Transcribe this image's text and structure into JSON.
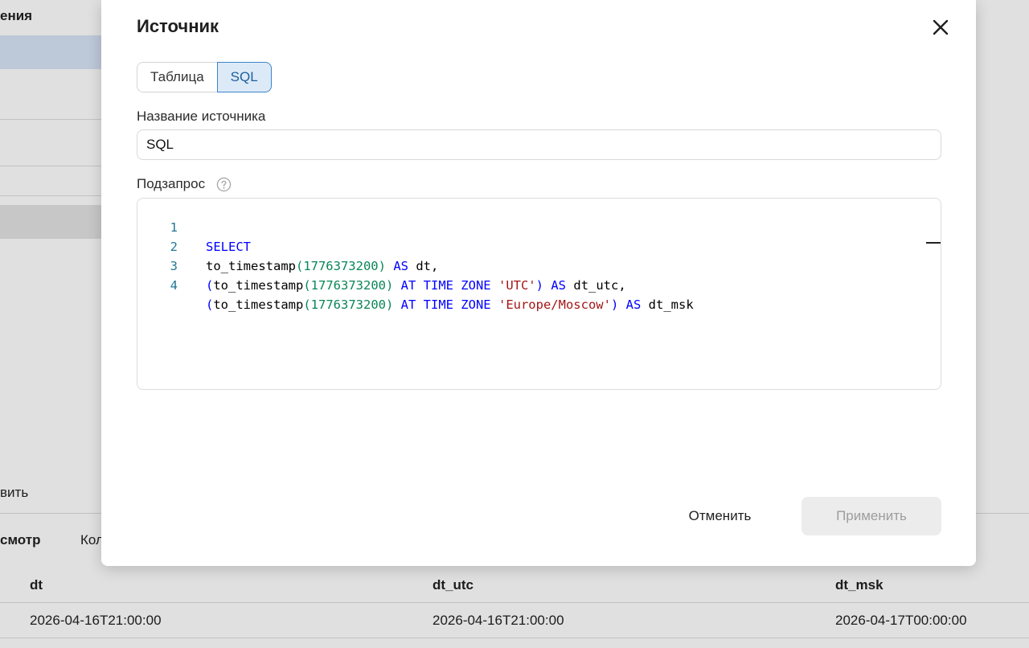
{
  "background": {
    "left_panel_title_fragment": "ения",
    "left_panel_action_fragment": "вить",
    "bottom_tabs": {
      "active_fragment": "смотр",
      "second_fragment": "Кол"
    },
    "preview_table": {
      "columns": [
        "dt",
        "dt_utc",
        "dt_msk"
      ],
      "rows": [
        [
          "2026-04-16T21:00:00",
          "2026-04-16T21:00:00",
          "2026-04-17T00:00:00"
        ]
      ]
    }
  },
  "dialog": {
    "title": "Источник",
    "close_icon": "close-icon",
    "source_type_tabs": [
      {
        "label": "Таблица",
        "active": false
      },
      {
        "label": "SQL",
        "active": true
      }
    ],
    "source_name": {
      "label": "Название источника",
      "value": "SQL"
    },
    "subquery": {
      "label": "Подзапрос",
      "help_icon": "question-circle-icon",
      "line_numbers": [
        "1",
        "2",
        "3",
        "4"
      ],
      "code_lines": [
        "SELECT",
        "to_timestamp(1776373200) AS dt,",
        "(to_timestamp(1776373200) AT TIME ZONE 'UTC') AS dt_utc,",
        "(to_timestamp(1776373200) AT TIME ZONE 'Europe/Moscow') AS dt_msk"
      ],
      "syntax_colors": {
        "keyword": "#0000ff",
        "number": "#098658",
        "string": "#a31515",
        "line_number": "#237893"
      }
    },
    "buttons": {
      "cancel": "Отменить",
      "apply": "Применить",
      "apply_enabled": false
    }
  }
}
